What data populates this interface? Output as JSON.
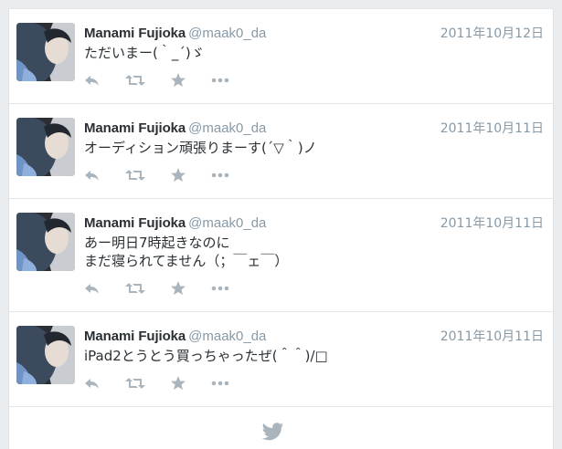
{
  "colors": {
    "name": "#292f33",
    "secondary": "#8899a6",
    "action_icon": "#a9b4bc",
    "page_background": "#e9edf0"
  },
  "tweets": [
    {
      "name": "Manami Fujioka",
      "handle": "@maak0_da",
      "time": "2011年10月12日",
      "text": "ただいまー(｀_´)ゞ"
    },
    {
      "name": "Manami Fujioka",
      "handle": "@maak0_da",
      "time": "2011年10月11日",
      "text": "オーディション頑張りまーす(´▽｀)ノ"
    },
    {
      "name": "Manami Fujioka",
      "handle": "@maak0_da",
      "time": "2011年10月11日",
      "text": "あー明日7時起きなのに\nまだ寝られてません（；￣ェ￣）"
    },
    {
      "name": "Manami Fujioka",
      "handle": "@maak0_da",
      "time": "2011年10月11日",
      "text": "iPad2とうとう買っちゃったぜ(＾＾)/□"
    }
  ],
  "icons": {
    "reply": "reply-icon",
    "retweet": "retweet-icon",
    "favorite": "star-icon",
    "more": "more-icon",
    "footer": "twitter-bird-icon"
  }
}
